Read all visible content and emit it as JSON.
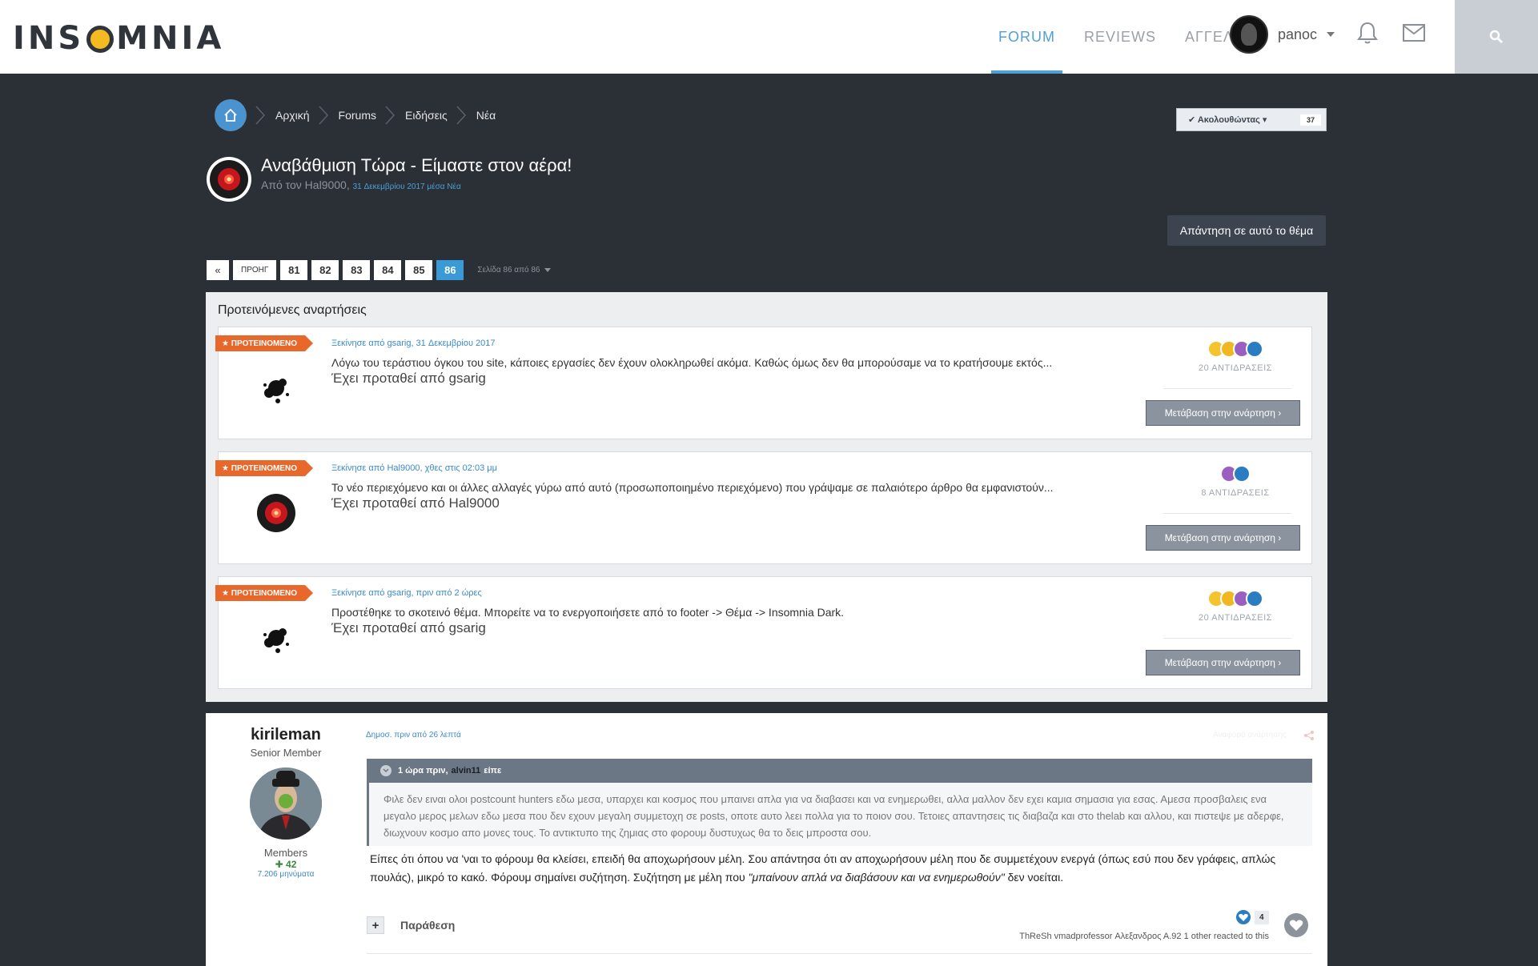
{
  "header": {
    "logo": {
      "left": "INS",
      "right": "MNIA"
    },
    "nav": [
      {
        "label": "FORUM",
        "active": true
      },
      {
        "label": "REVIEWS",
        "active": false
      },
      {
        "label": "ΑΓΓΕΛΙΕΣ",
        "active": false
      }
    ],
    "user_name": "panoc",
    "icons": [
      "bell-icon",
      "mail-icon",
      "search-icon"
    ]
  },
  "breadcrumb": {
    "items": [
      "Αρχική",
      "Forums",
      "Ειδήσεις",
      "Νέα"
    ]
  },
  "follow": {
    "label": "✔ Ακολουθώντας ▾",
    "count": "37"
  },
  "topic": {
    "title": "Αναβάθμιση Τώρα - Είμαστε στον αέρα!",
    "author_prefix": "Από τον Hal9000,",
    "meta": "31 Δεκεμβρίου 2017 μέσα Νέα"
  },
  "reply_button": "Απάντηση σε αυτό το θέμα",
  "pagination": {
    "first": "«",
    "prev": "ΠΡΟΗΓ",
    "pages": [
      "81",
      "82",
      "83",
      "84",
      "85",
      "86"
    ],
    "current": "86",
    "info": "Σελίδα 86 από 86"
  },
  "featured": {
    "heading": "Προτεινόμενες αναρτήσεις",
    "badge": "ΠΡΟΤΕΙΝΟΜΕΝΟ",
    "go_button": "Μετάβαση στην ανάρτηση ›",
    "items": [
      {
        "meta": "Ξεκίνησε από gsarig, 31 Δεκεμβρίου 2017",
        "excerpt": "Λόγω του τεράστιου όγκου του site, κάποιες εργασίες δεν έχουν ολοκληρωθεί ακόμα. Καθώς όμως δεν θα μπορούσαμε να το κρατήσουμε εκτός...",
        "by": "Έχει προταθεί από gsarig",
        "reactions": "20 ΑΝΤΙΔΡΑΣΕΙΣ"
      },
      {
        "meta": "Ξεκίνησε από Hal9000, χθες στις 02:03 μμ",
        "excerpt": "Το νέο περιεχόμενο και οι άλλες αλλαγές γύρω από αυτό (προσωποποιημένο περιεχόμενο) που γράψαμε σε παλαιότερο άρθρο θα εμφανιστούν...",
        "by": "Έχει προταθεί από Hal9000",
        "reactions": "8 ΑΝΤΙΔΡΑΣΕΙΣ"
      },
      {
        "meta": "Ξεκίνησε από gsarig, πριν από 2 ώρες",
        "excerpt": "Προστέθηκε το σκοτεινό θέμα. Μπορείτε να το ενεργοποιήσετε από το footer -> Θέμα -> Insomnia Dark.",
        "by": "Έχει προταθεί από gsarig",
        "reactions": "20 ΑΝΤΙΔΡΑΣΕΙΣ"
      }
    ]
  },
  "post": {
    "author": "kirileman",
    "rank": "Senior Member",
    "group": "Members",
    "reputation": "✚ 42",
    "post_count": "7.206 μηνύματα",
    "date": "Δημοσ. πριν από 26 λεπτά",
    "report": "Αναφορά ανάρτησης",
    "quote": {
      "time": "1 ώρα πριν,",
      "author": "alvin11",
      "said": "είπε",
      "text": "Φιλε δεν ειναι ολοι postcount hunters εδω μεσα, υπαρχει και κοσμος που μπαινει απλα για να διαβασει και να ενημερωθει, αλλα μαλλον δεν εχει καμια σημασια για εσας. Αμεσα προσβαλεις ενα μεγαλο μερος μελων εδω μεσα που δεν εχουν μεγαλη συμμετοχη σε posts, οποτε αυτο λεει πολλα για το ποιον σου. Τετοιες απαντησεις τις διαβαζα και στο thelab και αλλου, και πιστεψε με αδερφε, διωχνουν κοσμο απο μονες τους. Το αντικτυπο της ζημιας στο φορουμ δυστυχως θα το δεις μπροστα σου."
    },
    "body_1": "Είπες ότι όπου να 'ναι το φόρουμ θα κλείσει, επειδή θα αποχωρήσουν μέλη. Σου απάντησα ότι αν αποχωρήσουν μέλη που δε συμμετέχουν ενεργά (όπως εσύ που δεν γράφεις, απλώς πουλάς), μικρό το κακό. Φόρουμ σημαίνει συζήτηση. Συζήτηση με μέλη που ",
    "body_em": "\"μπαίνουν απλά να διαβάσουν και να ενημερωθούν\"",
    "body_2": " δεν νοείται.",
    "quote_button": "Παράθεση",
    "reaction_count": "4",
    "reacted_by": "ThReSh vmadprofessor Αλεξανδρος Α.92 1 other reacted to this"
  }
}
